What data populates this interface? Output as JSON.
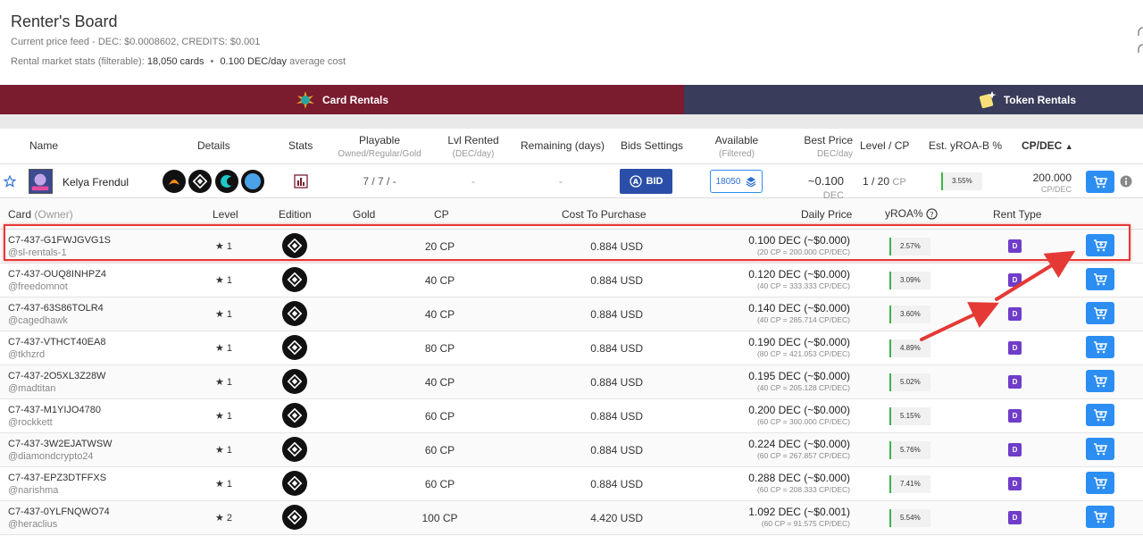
{
  "header": {
    "title": "Renter's Board",
    "price_feed": "Current price feed - DEC: $0.0008602, CREDITS: $0.001",
    "market_stats_label": "Rental market stats (filterable):",
    "market_cards": "18,050 cards",
    "market_sep": "•",
    "market_avg": "0.100 DEC/day",
    "market_avg_label": "average cost"
  },
  "tabs": {
    "card_rentals": "Card Rentals",
    "token_rentals": "Token Rentals"
  },
  "main_table": {
    "headers": {
      "name": "Name",
      "details": "Details",
      "stats": "Stats",
      "playable": "Playable",
      "playable_sub": "Owned/Regular/Gold",
      "lvl_rented": "Lvl Rented",
      "lvl_rented_sub": "(DEC/day)",
      "remaining": "Remaining (days)",
      "bids": "Bids Settings",
      "available": "Available",
      "available_sub": "(Filtered)",
      "best_price": "Best Price",
      "best_price_sub": "DEC/day",
      "level_cp": "Level / CP",
      "yroa_b": "Est. yROA-B %",
      "cp_dec": "CP/DEC",
      "cp_dec_sort": "▲"
    },
    "row": {
      "name": "Kelya Frendul",
      "playable": "7 / 7 / -",
      "lvl_rented": "-",
      "remaining": "-",
      "bid_label": "BID",
      "available": "18050",
      "best_price": "~0.100",
      "best_price_unit": "DEC",
      "level": "1 / 20",
      "level_unit": "CP",
      "yroa_b": "3.55%",
      "cp_dec": "200.000",
      "cp_dec_unit": "CP/DEC"
    }
  },
  "sub_table": {
    "headers": {
      "card": "Card",
      "owner": "(Owner)",
      "level": "Level",
      "edition": "Edition",
      "gold": "Gold",
      "cp": "CP",
      "cost": "Cost To Purchase",
      "daily_price": "Daily Price",
      "yroa": "yROA%",
      "rent_type": "Rent Type"
    },
    "rows": [
      {
        "id": "C7-437-G1FWJGVG1S",
        "owner": "@sl-rentals-1",
        "level": "★ 1",
        "cp": "20 CP",
        "cost": "0.884 USD",
        "price": "0.100 DEC (~$0.000)",
        "price_sub": "(20 CP = 200.000 CP/DEC)",
        "yroa": "2.57%",
        "rent_type": "D"
      },
      {
        "id": "C7-437-OUQ8INHPZ4",
        "owner": "@freedomnot",
        "level": "★ 1",
        "cp": "40 CP",
        "cost": "0.884 USD",
        "price": "0.120 DEC (~$0.000)",
        "price_sub": "(40 CP = 333.333 CP/DEC)",
        "yroa": "3.09%",
        "rent_type": "D"
      },
      {
        "id": "C7-437-63S86TOLR4",
        "owner": "@cagedhawk",
        "level": "★ 1",
        "cp": "40 CP",
        "cost": "0.884 USD",
        "price": "0.140 DEC (~$0.000)",
        "price_sub": "(40 CP = 285.714 CP/DEC)",
        "yroa": "3.60%",
        "rent_type": "D"
      },
      {
        "id": "C7-437-VTHCT40EA8",
        "owner": "@tkhzrd",
        "level": "★ 1",
        "cp": "80 CP",
        "cost": "0.884 USD",
        "price": "0.190 DEC (~$0.000)",
        "price_sub": "(80 CP = 421.053 CP/DEC)",
        "yroa": "4.89%",
        "rent_type": "D"
      },
      {
        "id": "C7-437-2O5XL3Z28W",
        "owner": "@madtitan",
        "level": "★ 1",
        "cp": "40 CP",
        "cost": "0.884 USD",
        "price": "0.195 DEC (~$0.000)",
        "price_sub": "(40 CP = 205.128 CP/DEC)",
        "yroa": "5.02%",
        "rent_type": "D"
      },
      {
        "id": "C7-437-M1YIJO4780",
        "owner": "@rockkett",
        "level": "★ 1",
        "cp": "60 CP",
        "cost": "0.884 USD",
        "price": "0.200 DEC (~$0.000)",
        "price_sub": "(60 CP = 300.000 CP/DEC)",
        "yroa": "5.15%",
        "rent_type": "D"
      },
      {
        "id": "C7-437-3W2EJATWSW",
        "owner": "@diamondcrypto24",
        "level": "★ 1",
        "cp": "60 CP",
        "cost": "0.884 USD",
        "price": "0.224 DEC (~$0.000)",
        "price_sub": "(60 CP = 267.857 CP/DEC)",
        "yroa": "5.76%",
        "rent_type": "D"
      },
      {
        "id": "C7-437-EPZ3DTFFXS",
        "owner": "@narishma",
        "level": "★ 1",
        "cp": "60 CP",
        "cost": "0.884 USD",
        "price": "0.288 DEC (~$0.000)",
        "price_sub": "(60 CP = 208.333 CP/DEC)",
        "yroa": "7.41%",
        "rent_type": "D"
      },
      {
        "id": "C7-437-0YLFNQWO74",
        "owner": "@heraclius",
        "level": "★ 2",
        "cp": "100 CP",
        "cost": "4.420 USD",
        "price": "1.092 DEC (~$0.001)",
        "price_sub": "(60 CP = 91.575 CP/DEC)",
        "yroa": "5.54%",
        "rent_type": "D"
      }
    ]
  },
  "colors": {
    "card_tab": "#7a1b2e",
    "token_tab": "#393c5a",
    "cart_button": "#2c8ef2",
    "rent_type": "#6f3dc9",
    "yroa_bar": "#3bb44a",
    "annotation": "#e53935"
  },
  "icons": [
    "star-icon",
    "stats-icon",
    "bid-icon",
    "layers-icon",
    "cart-icon",
    "info-icon",
    "help-icon",
    "edition-icon",
    "link-icon"
  ]
}
